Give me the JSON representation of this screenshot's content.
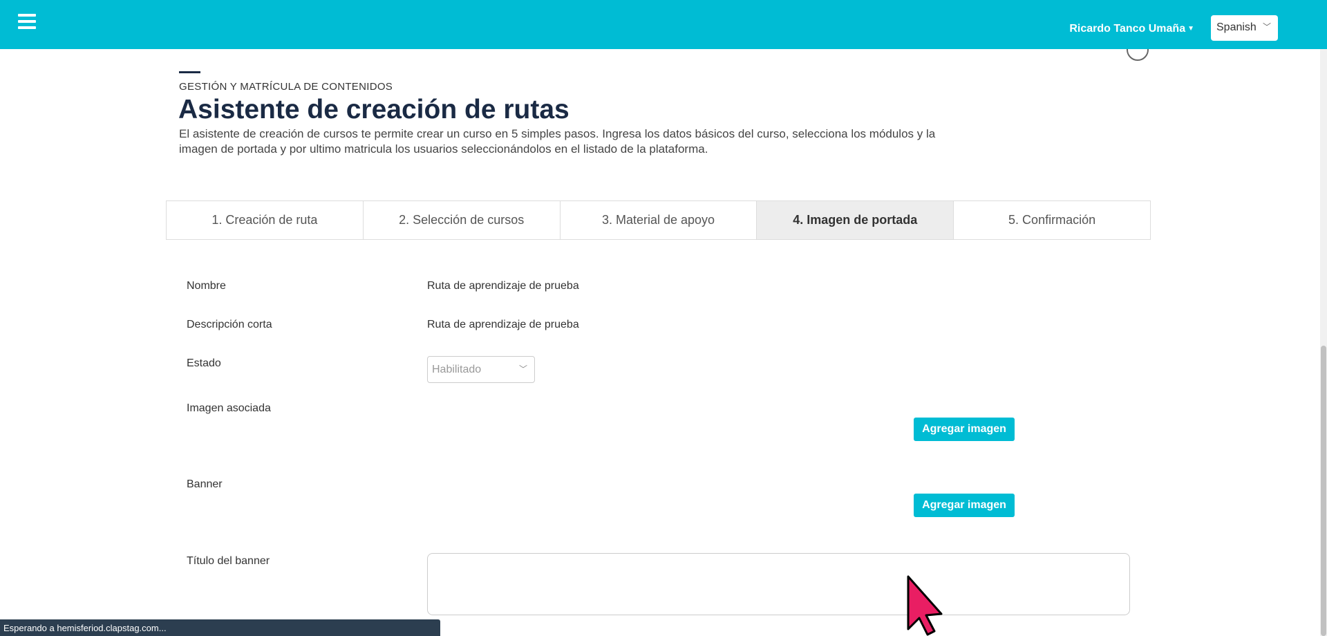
{
  "header": {
    "user_name": "Ricardo Tanco Umaña",
    "language": "Spanish"
  },
  "page": {
    "eyebrow": "GESTIÓN Y MATRÍCULA DE CONTENIDOS",
    "title": "Asistente de creación de rutas",
    "description_line1": "El asistente de creación de cursos te permite crear un curso en 5 simples pasos. Ingresa los datos básicos del curso, selecciona los módulos y la",
    "description_line2": "imagen de portada y por ultimo matricula los usuarios seleccionándolos en el listado de la plataforma."
  },
  "tabs": [
    {
      "label": "1. Creación de ruta"
    },
    {
      "label": "2. Selección de cursos"
    },
    {
      "label": "3. Material de apoyo"
    },
    {
      "label": "4. Imagen de portada",
      "active": true
    },
    {
      "label": "5. Confirmación"
    }
  ],
  "form": {
    "name_label": "Nombre",
    "name_value": "Ruta de aprendizaje de prueba",
    "short_desc_label": "Descripción corta",
    "short_desc_value": "Ruta de aprendizaje de prueba",
    "status_label": "Estado",
    "status_value": "Habilitado",
    "image_label": "Imagen asociada",
    "banner_label": "Banner",
    "add_image_label": "Agregar imagen",
    "banner_title_label": "Título del banner"
  },
  "statusbar": {
    "text": "Esperando a hemisferiod.clapstag.com..."
  },
  "colors": {
    "accent": "#00bcd4",
    "title": "#1a2a44",
    "cursor": "#e91e63"
  }
}
